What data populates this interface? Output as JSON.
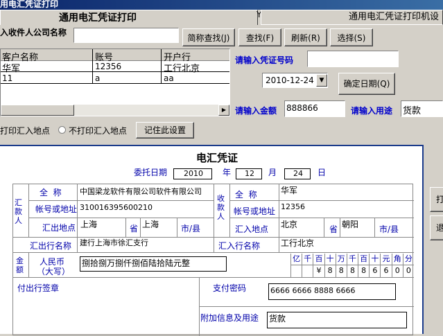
{
  "window": {
    "title": "用电汇凭证打印"
  },
  "tabs": {
    "active": "通用电汇凭证打印",
    "inactive": "通用电汇凭证打印机设"
  },
  "search": {
    "label": "入收件人公司名称",
    "value": "",
    "abbr_btn": "简称查找(J)",
    "find_btn": "查找(F)",
    "refresh_btn": "刷新(R)",
    "select_btn": "选择(S)"
  },
  "list": {
    "headers": [
      "客户名称",
      "账号",
      "开户行"
    ],
    "rows": [
      [
        "华军",
        "12356",
        "工行北京"
      ],
      [
        "11",
        "a",
        "aa"
      ]
    ]
  },
  "voucher_no": {
    "label": "请输入凭证号码",
    "value": ""
  },
  "date": {
    "value": "2010-12-24",
    "confirm_btn": "确定日期(Q)"
  },
  "amount": {
    "label": "请输入金额",
    "value": "888866"
  },
  "purpose": {
    "label": "请输入用途",
    "value": "货款"
  },
  "print_opts": {
    "opt1": "打印汇入地点",
    "opt2": "不打印汇入地点",
    "save_btn": "记住此设置"
  },
  "right_btns": {
    "b1": "打",
    "b2": "退"
  },
  "voucher": {
    "title": "电汇凭证",
    "date_label": "委托日期",
    "year": "2010",
    "year_l": "年",
    "month": "12",
    "month_l": "月",
    "day": "24",
    "day_l": "日",
    "remitter": {
      "side": "汇款人",
      "name_l": "全  称",
      "name": "中国梁龙软件有限公司软件有限公司",
      "acct_l": "帐号或地址",
      "acct": "310016395600210",
      "place_l": "汇出地点",
      "prov": "上海",
      "prov_l": "省",
      "city": "上海",
      "city_l": "市/县",
      "bank_l": "汇出行名称",
      "bank": "建行上海市徐汇支行"
    },
    "payee": {
      "side": "收款人",
      "name_l": "全  称",
      "name": "华军",
      "acct_l": "帐号或地址",
      "acct": "12356",
      "place_l": "汇入地点",
      "prov": "北京",
      "prov_l": "省",
      "city": "朝阳",
      "city_l": "市/县",
      "bank_l": "汇入行名称",
      "bank": "工行北京"
    },
    "amount": {
      "side": "金额",
      "rmb": "人民币",
      "rmb2": "（大写）",
      "capital": "捌拾捌万捌仟捌佰陆拾陆元整",
      "units": [
        "亿",
        "千",
        "百",
        "十",
        "万",
        "千",
        "百",
        "十",
        "元",
        "角",
        "分"
      ],
      "digits": [
        "",
        "",
        "¥",
        "8",
        "8",
        "8",
        "8",
        "6",
        "6",
        "0",
        "0"
      ]
    },
    "sign_l": "付出行签章",
    "pwd_l": "支付密码",
    "pwd": "6666 6666 8888 6666",
    "extra_l": "附加信息及用途",
    "extra": "货款"
  }
}
